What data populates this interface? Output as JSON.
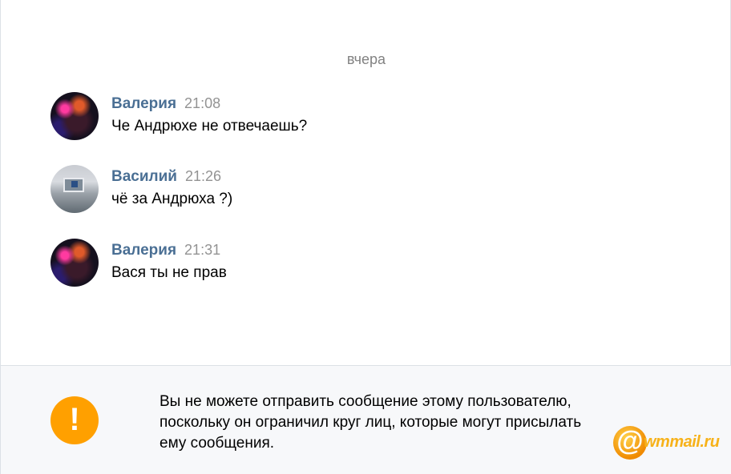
{
  "history": {
    "date_separator": "вчера",
    "messages": [
      {
        "author": "Валерия",
        "time": "21:08",
        "text": "Че Андрюхе не отвечаешь?"
      },
      {
        "author": "Василий",
        "time": "21:26",
        "text": "чё за Андрюха ?)"
      },
      {
        "author": "Валерия",
        "time": "21:31",
        "text": "Вася ты не прав"
      }
    ]
  },
  "notice": {
    "icon": "exclamation-icon",
    "icon_glyph": "!",
    "accent_color": "#ffa000",
    "lines": [
      "Вы не можете отправить сообщение этому пользователю,",
      "поскольку он ограничил круг лиц, которые могут присылать",
      "ему сообщения."
    ]
  },
  "watermark": {
    "glyph": "@",
    "brand": "wmmail.ru"
  },
  "colors": {
    "author": "#4a6f94",
    "time": "#939393",
    "date": "#828282",
    "notice_bg": "#f7f8fa"
  }
}
